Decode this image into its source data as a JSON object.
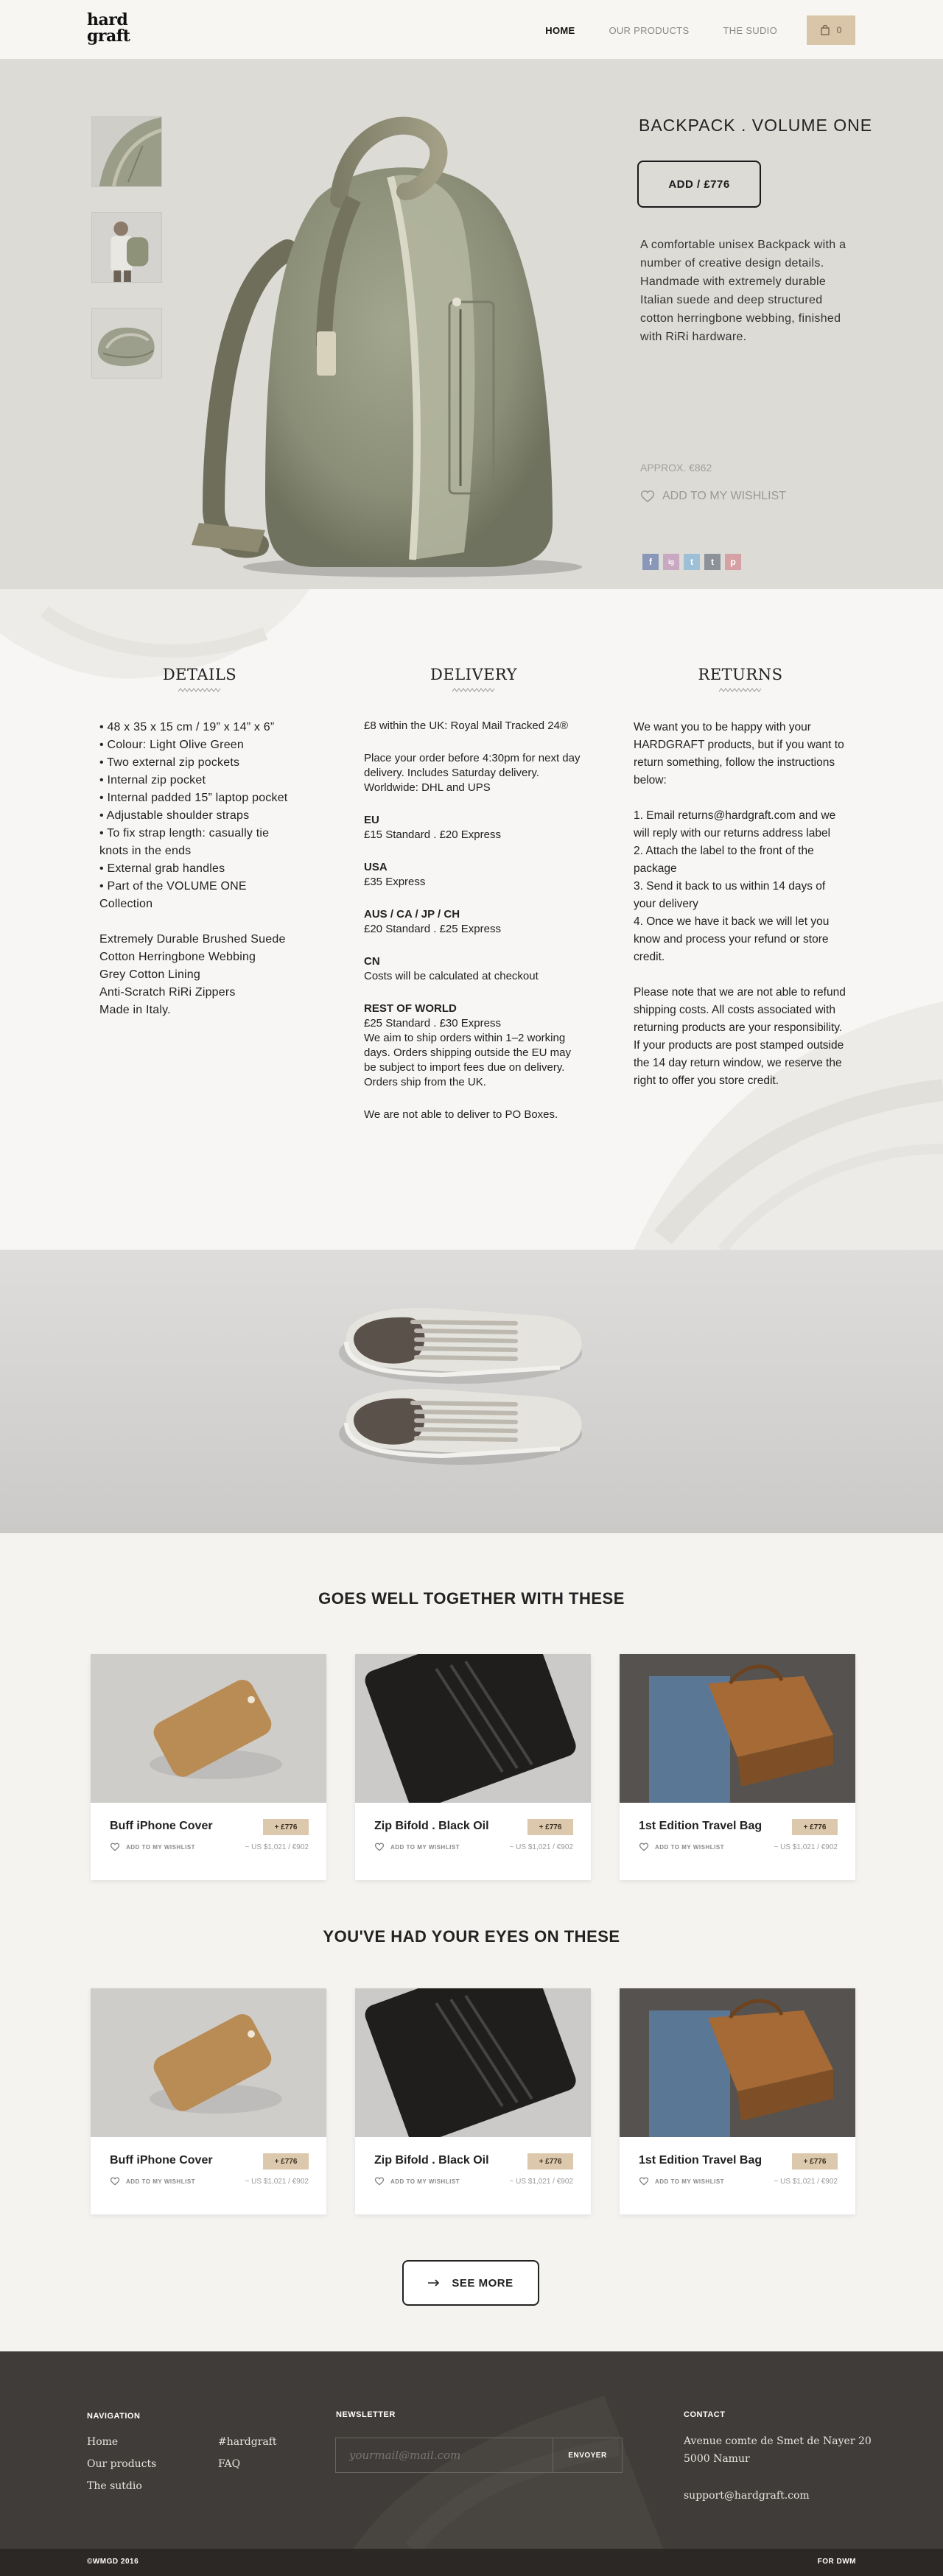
{
  "header": {
    "logo_line1": "hard",
    "logo_line2": "graft",
    "nav": [
      "HOME",
      "OUR PRODUCTS",
      "THE SUDIO"
    ],
    "cart_count": "0"
  },
  "product": {
    "title": "BACKPACK . VOLUME ONE",
    "add_button": "ADD / £776",
    "description": "A comfortable unisex Backpack with a number of creative design details. Handmade with extremely durable Italian suede and deep structured cotton herringbone webbing, finished with RiRi hardware.",
    "approx": "APPROX. €862",
    "wishlist": "ADD TO MY WISHLIST",
    "social": [
      "f",
      "ig",
      "t",
      "t",
      "p"
    ]
  },
  "details": {
    "title": "DETAILS",
    "bullets": [
      "48 x 35 x 15 cm / 19” x 14” x 6”",
      "Colour: Light Olive Green",
      "Two external zip pockets",
      "Internal zip pocket",
      "Internal padded 15” laptop pocket",
      "Adjustable shoulder straps",
      "To fix strap length: casually tie knots in the ends",
      "External grab handles",
      "Part of the VOLUME ONE Collection"
    ],
    "materials": [
      "Extremely Durable Brushed Suede",
      "Cotton Herringbone Webbing",
      "Grey Cotton Lining",
      "Anti-Scratch RiRi Zippers",
      "Made in Italy."
    ]
  },
  "delivery": {
    "title": "DELIVERY",
    "intro": "£8 within the UK: Royal Mail Tracked 24®",
    "note": "Place your order before 4:30pm for next day delivery. Includes Saturday delivery. Worldwide: DHL and UPS",
    "eu_h": "EU",
    "eu": "£15 Standard . £20 Express",
    "usa_h": "USA",
    "usa": "£35 Express",
    "aus_h": "AUS / CA / JP / CH",
    "aus": "£20 Standard . £25 Express",
    "cn_h": "CN",
    "cn": "Costs will be calculated at checkout",
    "row_h": "REST OF WORLD",
    "row": "£25 Standard . £30 Express",
    "row_note": "We aim to ship orders within 1–2 working days. Orders shipping outside the EU may be subject to import fees due on delivery. Orders ship from the UK.",
    "po": "We are not able to deliver to PO Boxes."
  },
  "returns": {
    "title": "RETURNS",
    "intro": "We want you to be happy with your HARDGRAFT products, but if you want to return something, follow the instructions below:",
    "steps": [
      "1. Email returns@hardgraft.com and we will reply with our returns address label",
      "2. Attach the label to the front of the package",
      "3. Send it back to us within 14 days of your delivery",
      "4. Once we have it back we will let you know and process your refund or store credit."
    ],
    "note": "Please note that we are not able to refund shipping costs. All costs associated with returning products are your responsibility. If your products are post stamped outside the 14 day return window, we reserve the right to offer you store credit."
  },
  "together": {
    "title": "GOES WELL TOGETHER WITH THESE",
    "items": [
      {
        "name": "Buff iPhone Cover",
        "price": "+ £776",
        "wish": "ADD TO MY WISHLIST",
        "usd": "~ US $1,021 / €902"
      },
      {
        "name": "Zip Bifold . Black Oil",
        "price": "+ £776",
        "wish": "ADD TO MY WISHLIST",
        "usd": "~ US $1,021 / €902"
      },
      {
        "name": "1st Edition Travel Bag",
        "price": "+ £776",
        "wish": "ADD TO MY WISHLIST",
        "usd": "~ US $1,021 / €902"
      }
    ]
  },
  "eyes": {
    "title": "YOU'VE HAD YOUR EYES ON THESE",
    "items": [
      {
        "name": "Buff iPhone Cover",
        "price": "+ £776",
        "wish": "ADD TO MY WISHLIST",
        "usd": "~ US $1,021 / €902"
      },
      {
        "name": "Zip Bifold . Black Oil",
        "price": "+ £776",
        "wish": "ADD TO MY WISHLIST",
        "usd": "~ US $1,021 / €902"
      },
      {
        "name": "1st Edition Travel Bag",
        "price": "+ £776",
        "wish": "ADD TO MY WISHLIST",
        "usd": "~ US $1,021 / €902"
      }
    ],
    "see_more": "SEE MORE"
  },
  "footer": {
    "nav_h": "NAVIGATION",
    "nav_links": [
      "Home",
      "Our products",
      "The sutdio"
    ],
    "nav_links2": [
      "#hardgraft",
      "FAQ"
    ],
    "news_h": "NEWSLETTER",
    "news_placeholder": "yourmail@mail.com",
    "news_button": "ENVOYER",
    "contact_h": "CONTACT",
    "address1": "Avenue comte de Smet de Nayer 20",
    "address2": "5000 Namur",
    "email": "support@hardgraft.com",
    "copyright": "©WMGD 2016",
    "credit": "FOR DWM"
  }
}
